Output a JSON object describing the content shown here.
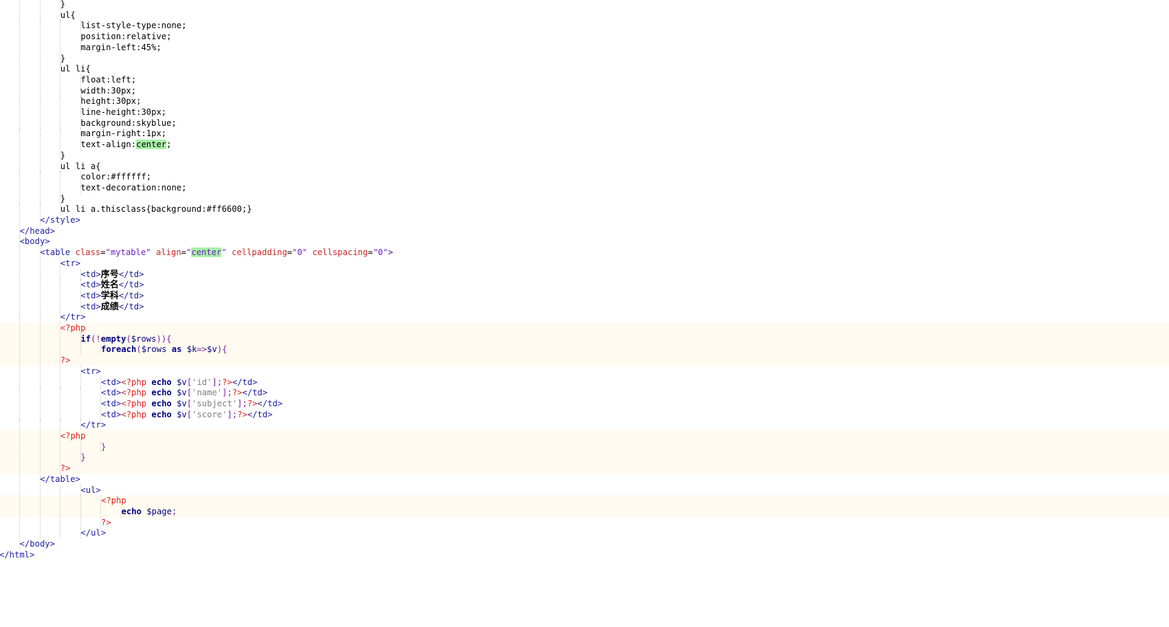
{
  "editor": {
    "lines": [
      {
        "indent": 3,
        "php": false,
        "tokens": [
          {
            "t": "}",
            "c": "t-css"
          }
        ]
      },
      {
        "indent": 3,
        "php": false,
        "tokens": [
          {
            "t": "ul{",
            "c": "t-css"
          }
        ]
      },
      {
        "indent": 4,
        "php": false,
        "tokens": [
          {
            "t": "list-style-type:none;",
            "c": "t-css"
          }
        ]
      },
      {
        "indent": 4,
        "php": false,
        "tokens": [
          {
            "t": "position:relative;",
            "c": "t-css"
          }
        ]
      },
      {
        "indent": 4,
        "php": false,
        "tokens": [
          {
            "t": "margin-left:45%;",
            "c": "t-css"
          }
        ]
      },
      {
        "indent": 3,
        "php": false,
        "tokens": [
          {
            "t": "}",
            "c": "t-css"
          }
        ]
      },
      {
        "indent": 3,
        "php": false,
        "tokens": [
          {
            "t": "ul li{",
            "c": "t-css"
          }
        ]
      },
      {
        "indent": 4,
        "php": false,
        "tokens": [
          {
            "t": "float:left;",
            "c": "t-css"
          }
        ]
      },
      {
        "indent": 4,
        "php": false,
        "tokens": [
          {
            "t": "width:30px;",
            "c": "t-css"
          }
        ]
      },
      {
        "indent": 4,
        "php": false,
        "tokens": [
          {
            "t": "height:30px;",
            "c": "t-css"
          }
        ]
      },
      {
        "indent": 4,
        "php": false,
        "tokens": [
          {
            "t": "line-height:30px;",
            "c": "t-css"
          }
        ]
      },
      {
        "indent": 4,
        "php": false,
        "tokens": [
          {
            "t": "background:skyblue;",
            "c": "t-css"
          }
        ]
      },
      {
        "indent": 4,
        "php": false,
        "tokens": [
          {
            "t": "margin-right:1px;",
            "c": "t-css"
          }
        ]
      },
      {
        "indent": 4,
        "php": false,
        "tokens": [
          {
            "t": "text-align:",
            "c": "t-css"
          },
          {
            "t": "center",
            "c": "t-css hl"
          },
          {
            "t": ";",
            "c": "t-css"
          }
        ]
      },
      {
        "indent": 3,
        "php": false,
        "tokens": [
          {
            "t": "}",
            "c": "t-css"
          }
        ]
      },
      {
        "indent": 3,
        "php": false,
        "tokens": [
          {
            "t": "ul li a{",
            "c": "t-css"
          }
        ]
      },
      {
        "indent": 4,
        "php": false,
        "tokens": [
          {
            "t": "color:#ffffff;",
            "c": "t-css"
          }
        ]
      },
      {
        "indent": 4,
        "php": false,
        "tokens": [
          {
            "t": "text-decoration:none;",
            "c": "t-css"
          }
        ]
      },
      {
        "indent": 3,
        "php": false,
        "tokens": [
          {
            "t": "}",
            "c": "t-css"
          }
        ]
      },
      {
        "indent": 3,
        "php": false,
        "tokens": [
          {
            "t": "ul li a.thisclass{background:#ff6600;}",
            "c": "t-css"
          }
        ]
      },
      {
        "indent": 2,
        "php": false,
        "tokens": [
          {
            "t": "</style>",
            "c": "t-tag"
          }
        ]
      },
      {
        "indent": 1,
        "php": false,
        "tokens": [
          {
            "t": "</head>",
            "c": "t-tag"
          }
        ]
      },
      {
        "indent": 1,
        "php": false,
        "tokens": [
          {
            "t": "<body>",
            "c": "t-tag"
          }
        ]
      },
      {
        "indent": 2,
        "php": false,
        "tokens": [
          {
            "t": "<table ",
            "c": "t-tag"
          },
          {
            "t": "class",
            "c": "t-attr"
          },
          {
            "t": "=",
            "c": "t-text"
          },
          {
            "t": "\"mytable\"",
            "c": "t-str"
          },
          {
            "t": " ",
            "c": "t-text"
          },
          {
            "t": "align",
            "c": "t-attr"
          },
          {
            "t": "=",
            "c": "t-text"
          },
          {
            "t": "\"",
            "c": "t-str"
          },
          {
            "t": "center",
            "c": "t-str hl"
          },
          {
            "t": "\"",
            "c": "t-str"
          },
          {
            "t": " ",
            "c": "t-text"
          },
          {
            "t": "cellpadding",
            "c": "t-attr"
          },
          {
            "t": "=",
            "c": "t-text"
          },
          {
            "t": "\"0\"",
            "c": "t-str"
          },
          {
            "t": " ",
            "c": "t-text"
          },
          {
            "t": "cellspacing",
            "c": "t-attr"
          },
          {
            "t": "=",
            "c": "t-text"
          },
          {
            "t": "\"0\"",
            "c": "t-str"
          },
          {
            "t": ">",
            "c": "t-tag"
          }
        ]
      },
      {
        "indent": 3,
        "php": false,
        "tokens": [
          {
            "t": "<tr>",
            "c": "t-tag"
          }
        ]
      },
      {
        "indent": 4,
        "php": false,
        "tokens": [
          {
            "t": "<td>",
            "c": "t-tag"
          },
          {
            "t": "序号",
            "c": "t-cjk"
          },
          {
            "t": "</td>",
            "c": "t-tag"
          }
        ]
      },
      {
        "indent": 4,
        "php": false,
        "tokens": [
          {
            "t": "<td>",
            "c": "t-tag"
          },
          {
            "t": "姓名",
            "c": "t-cjk"
          },
          {
            "t": "</td>",
            "c": "t-tag"
          }
        ]
      },
      {
        "indent": 4,
        "php": false,
        "tokens": [
          {
            "t": "<td>",
            "c": "t-tag"
          },
          {
            "t": "学科",
            "c": "t-cjk"
          },
          {
            "t": "</td>",
            "c": "t-tag"
          }
        ]
      },
      {
        "indent": 4,
        "php": false,
        "tokens": [
          {
            "t": "<td>",
            "c": "t-tag"
          },
          {
            "t": "成绩",
            "c": "t-cjk"
          },
          {
            "t": "</td>",
            "c": "t-tag"
          }
        ]
      },
      {
        "indent": 3,
        "php": false,
        "tokens": [
          {
            "t": "</tr>",
            "c": "t-tag"
          }
        ]
      },
      {
        "indent": 3,
        "php": true,
        "tokens": [
          {
            "t": "<?php",
            "c": "t-php"
          }
        ]
      },
      {
        "indent": 4,
        "php": true,
        "tokens": [
          {
            "t": "if",
            "c": "t-kw"
          },
          {
            "t": "(!",
            "c": "t-punc"
          },
          {
            "t": "empty",
            "c": "t-kw"
          },
          {
            "t": "(",
            "c": "t-punc"
          },
          {
            "t": "$rows",
            "c": "t-var"
          },
          {
            "t": ")){",
            "c": "t-punc"
          }
        ]
      },
      {
        "indent": 5,
        "php": true,
        "tokens": [
          {
            "t": "foreach",
            "c": "t-kw"
          },
          {
            "t": "(",
            "c": "t-punc"
          },
          {
            "t": "$rows",
            "c": "t-var"
          },
          {
            "t": " ",
            "c": "t-text"
          },
          {
            "t": "as",
            "c": "t-kw"
          },
          {
            "t": " ",
            "c": "t-text"
          },
          {
            "t": "$k",
            "c": "t-var"
          },
          {
            "t": "=>",
            "c": "t-punc"
          },
          {
            "t": "$v",
            "c": "t-var"
          },
          {
            "t": "){",
            "c": "t-punc"
          }
        ]
      },
      {
        "indent": 3,
        "php": true,
        "tokens": [
          {
            "t": "?>",
            "c": "t-php"
          }
        ]
      },
      {
        "indent": 4,
        "php": false,
        "tokens": [
          {
            "t": "<tr>",
            "c": "t-tag"
          }
        ]
      },
      {
        "indent": 5,
        "php": false,
        "tokens": [
          {
            "t": "<td>",
            "c": "t-tag"
          },
          {
            "t": "<?php",
            "c": "t-php"
          },
          {
            "t": " ",
            "c": "t-text"
          },
          {
            "t": "echo",
            "c": "t-kw"
          },
          {
            "t": " ",
            "c": "t-text"
          },
          {
            "t": "$v",
            "c": "t-var"
          },
          {
            "t": "[",
            "c": "t-punc"
          },
          {
            "t": "'id'",
            "c": "t-sqstr"
          },
          {
            "t": "];",
            "c": "t-punc"
          },
          {
            "t": "?>",
            "c": "t-php"
          },
          {
            "t": "</td>",
            "c": "t-tag"
          }
        ]
      },
      {
        "indent": 5,
        "php": false,
        "tokens": [
          {
            "t": "<td>",
            "c": "t-tag"
          },
          {
            "t": "<?php",
            "c": "t-php"
          },
          {
            "t": " ",
            "c": "t-text"
          },
          {
            "t": "echo",
            "c": "t-kw"
          },
          {
            "t": " ",
            "c": "t-text"
          },
          {
            "t": "$v",
            "c": "t-var"
          },
          {
            "t": "[",
            "c": "t-punc"
          },
          {
            "t": "'name'",
            "c": "t-sqstr"
          },
          {
            "t": "];",
            "c": "t-punc"
          },
          {
            "t": "?>",
            "c": "t-php"
          },
          {
            "t": "</td>",
            "c": "t-tag"
          }
        ]
      },
      {
        "indent": 5,
        "php": false,
        "tokens": [
          {
            "t": "<td>",
            "c": "t-tag"
          },
          {
            "t": "<?php",
            "c": "t-php"
          },
          {
            "t": " ",
            "c": "t-text"
          },
          {
            "t": "echo",
            "c": "t-kw"
          },
          {
            "t": " ",
            "c": "t-text"
          },
          {
            "t": "$v",
            "c": "t-var"
          },
          {
            "t": "[",
            "c": "t-punc"
          },
          {
            "t": "'subject'",
            "c": "t-sqstr"
          },
          {
            "t": "];",
            "c": "t-punc"
          },
          {
            "t": "?>",
            "c": "t-php"
          },
          {
            "t": "</td>",
            "c": "t-tag"
          }
        ]
      },
      {
        "indent": 5,
        "php": false,
        "tokens": [
          {
            "t": "<td>",
            "c": "t-tag"
          },
          {
            "t": "<?php",
            "c": "t-php"
          },
          {
            "t": " ",
            "c": "t-text"
          },
          {
            "t": "echo",
            "c": "t-kw"
          },
          {
            "t": " ",
            "c": "t-text"
          },
          {
            "t": "$v",
            "c": "t-var"
          },
          {
            "t": "[",
            "c": "t-punc"
          },
          {
            "t": "'score'",
            "c": "t-sqstr"
          },
          {
            "t": "];",
            "c": "t-punc"
          },
          {
            "t": "?>",
            "c": "t-php"
          },
          {
            "t": "</td>",
            "c": "t-tag"
          }
        ]
      },
      {
        "indent": 4,
        "php": false,
        "tokens": [
          {
            "t": "</tr>",
            "c": "t-tag"
          }
        ]
      },
      {
        "indent": 3,
        "php": true,
        "tokens": [
          {
            "t": "<?php",
            "c": "t-php"
          }
        ]
      },
      {
        "indent": 5,
        "php": true,
        "tokens": [
          {
            "t": "}",
            "c": "t-punc"
          }
        ]
      },
      {
        "indent": 4,
        "php": true,
        "tokens": [
          {
            "t": "}",
            "c": "t-punc"
          }
        ]
      },
      {
        "indent": 3,
        "php": true,
        "tokens": [
          {
            "t": "?>",
            "c": "t-php"
          }
        ]
      },
      {
        "indent": 2,
        "php": false,
        "tokens": [
          {
            "t": "</table>",
            "c": "t-tag"
          }
        ]
      },
      {
        "indent": 4,
        "php": false,
        "tokens": [
          {
            "t": "<ul>",
            "c": "t-tag"
          }
        ]
      },
      {
        "indent": 5,
        "php": true,
        "tokens": [
          {
            "t": "<?php",
            "c": "t-php"
          }
        ]
      },
      {
        "indent": 6,
        "php": true,
        "tokens": [
          {
            "t": "echo",
            "c": "t-kw"
          },
          {
            "t": " ",
            "c": "t-text"
          },
          {
            "t": "$page",
            "c": "t-var"
          },
          {
            "t": ";",
            "c": "t-punc"
          }
        ]
      },
      {
        "indent": 5,
        "php": false,
        "tokens": [
          {
            "t": "?>",
            "c": "t-php"
          }
        ]
      },
      {
        "indent": 4,
        "php": false,
        "tokens": [
          {
            "t": "</ul>",
            "c": "t-tag"
          }
        ]
      },
      {
        "indent": 1,
        "php": false,
        "tokens": [
          {
            "t": "</body>",
            "c": "t-tag"
          }
        ]
      },
      {
        "indent": 0,
        "php": false,
        "tokens": [
          {
            "t": "</html>",
            "c": "t-tag"
          }
        ]
      }
    ]
  }
}
